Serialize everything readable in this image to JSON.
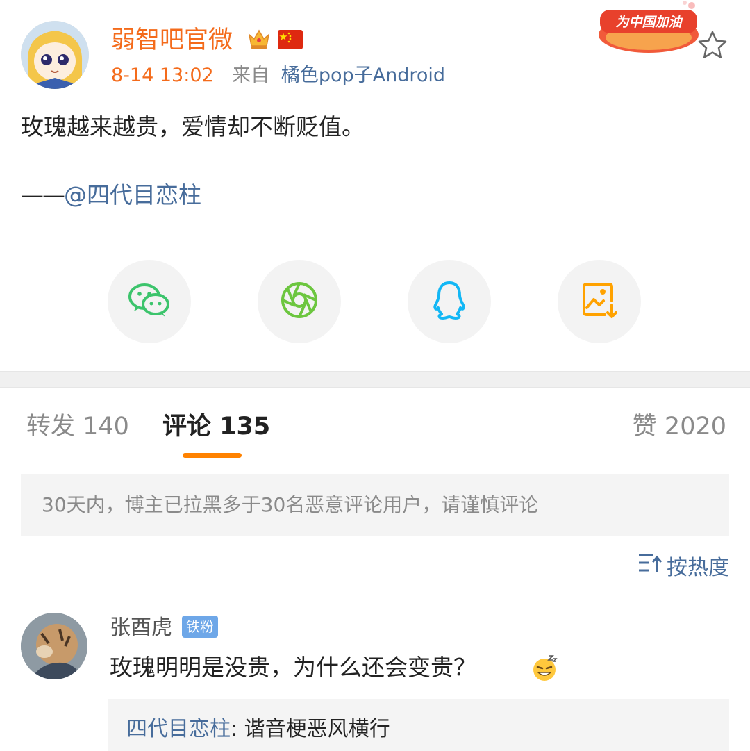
{
  "post": {
    "username": "弱智吧官微",
    "time": "8-14 13:02",
    "from_label": "来自",
    "device": "橘色pop子Android",
    "badge_text": "为中国加油",
    "text": "玫瑰越来越贵，爱情却不断贬值。",
    "attribution_dash": "——",
    "attribution_mention": "@四代目恋柱"
  },
  "share": [
    {
      "icon": "wechat-icon",
      "color": "#3cc46c"
    },
    {
      "icon": "moments-icon",
      "color": "#6cc63f"
    },
    {
      "icon": "qq-icon",
      "color": "#12b7f5"
    },
    {
      "icon": "save-image-icon",
      "color": "#ffa200"
    }
  ],
  "tabs": {
    "repost": "转发 140",
    "comments": "评论 135",
    "likes": "赞 2020"
  },
  "notice": "30天内，博主已拉黑多于30名恶意评论用户，请谨慎评论",
  "sort_label": "按热度",
  "comments": [
    {
      "user": "张酉虎",
      "badge": "铁粉",
      "text": "玫瑰明明是没贵，为什么还会变贵？",
      "reply_user": "四代目恋柱",
      "reply_sep": ": ",
      "reply_text": "谐音梗恶风横行"
    }
  ],
  "colors": {
    "accent": "#ff8200",
    "username": "#f46b1b",
    "link": "#476c9b",
    "muted": "#8a8a8a"
  }
}
